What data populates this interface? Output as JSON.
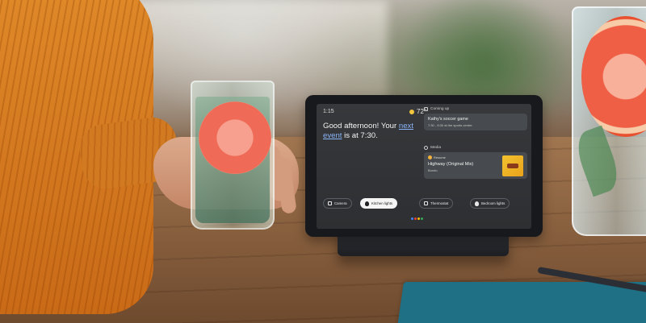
{
  "device": {
    "clock": "1:15",
    "weather": {
      "temp": "72°",
      "icon": "sun-icon",
      "icon_color": "#f3c53f"
    },
    "greeting": {
      "line1": "Good afternoon! Your",
      "link": "next event",
      "line2": " is at 7:30.",
      "link_color": "#8ab4f8"
    },
    "coming_up": {
      "header": "Coming up",
      "event_title": "Kathy's soccer game",
      "event_sub": "7:30 - 8:30 at the sports centre."
    },
    "media": {
      "header": "Media",
      "status": "Resume",
      "track": "Highway (Original Mix)",
      "artist": "Bundo"
    },
    "chips": [
      {
        "label": "Camera",
        "icon": "camera-icon"
      },
      {
        "label": "Kitchen lights",
        "icon": "bulb-icon",
        "active": true
      },
      {
        "label": "Thermostat",
        "icon": "thermostat-icon"
      },
      {
        "label": "Bedroom lights",
        "icon": "bulb-icon"
      }
    ],
    "assistant_colors": [
      "#4285f4",
      "#ea4335",
      "#fbbc05",
      "#34a853"
    ]
  }
}
